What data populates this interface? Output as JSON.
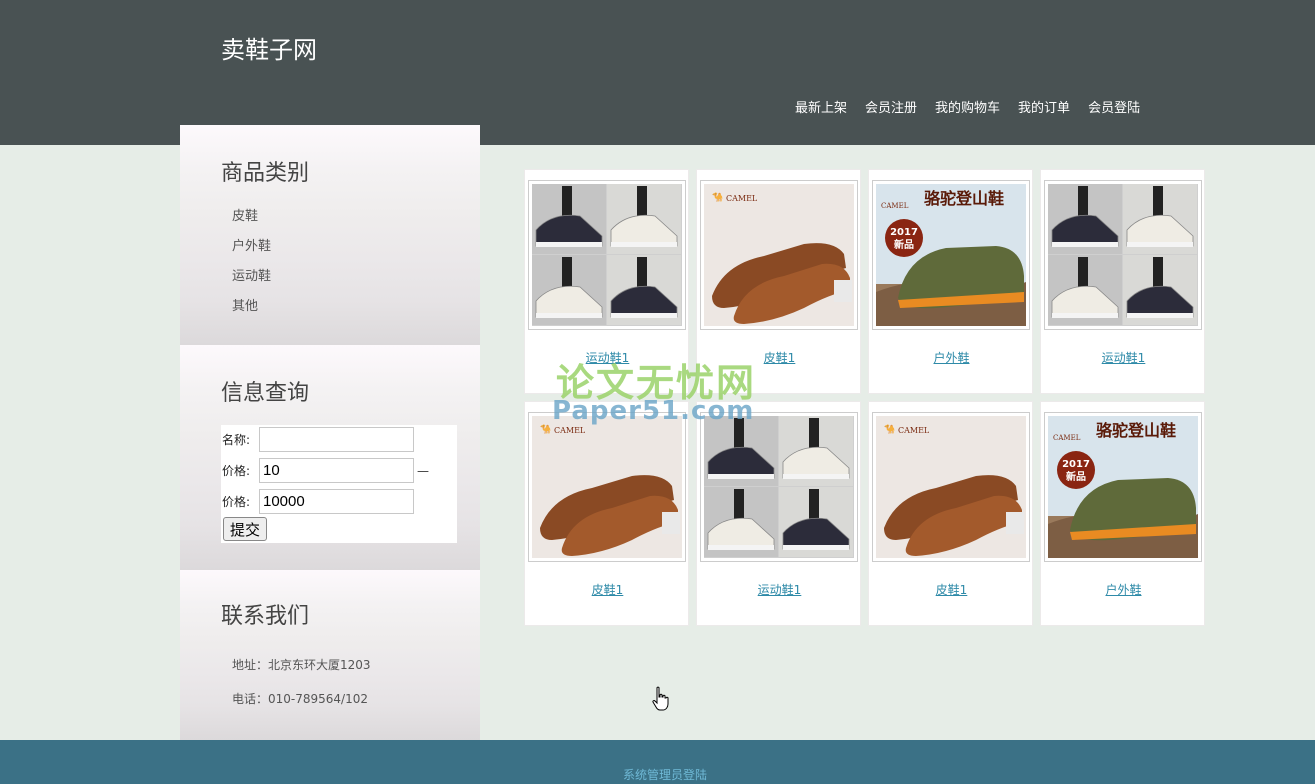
{
  "header": {
    "site_title": "卖鞋子网",
    "nav": [
      "最新上架",
      "会员注册",
      "我的购物车",
      "我的订单",
      "会员登陆"
    ]
  },
  "sidebar": {
    "categories": {
      "title": "商品类别",
      "items": [
        "皮鞋",
        "户外鞋",
        "运动鞋",
        "其他"
      ]
    },
    "search": {
      "title": "信息查询",
      "name_label": "名称:",
      "name_value": "",
      "price_label": "价格:",
      "price_min": "10",
      "price_sep": "—",
      "price_max": "10000",
      "submit": "提交"
    },
    "contact": {
      "title": "联系我们",
      "address": "地址：北京东环大厦1203",
      "phone": "电话：010-789564/102"
    }
  },
  "products": [
    {
      "name": "运动鞋1",
      "image": "sneakers"
    },
    {
      "name": "皮鞋1",
      "image": "leather-shoe"
    },
    {
      "name": "户外鞋",
      "image": "hiking-shoe"
    },
    {
      "name": "运动鞋1",
      "image": "sneakers"
    },
    {
      "name": "皮鞋1",
      "image": "leather-shoe"
    },
    {
      "name": "运动鞋1",
      "image": "sneakers"
    },
    {
      "name": "皮鞋1",
      "image": "leather-shoe"
    },
    {
      "name": "户外鞋",
      "image": "hiking-shoe"
    }
  ],
  "product_image_text": {
    "brand": "CAMEL",
    "banner": "骆驼登山鞋",
    "badge_year": "2017",
    "badge_label": "新品"
  },
  "watermark": {
    "cn": "论文无忧网",
    "en": "Paper51.com"
  },
  "footer": {
    "admin_link": "系统管理员登陆"
  },
  "colors": {
    "header_bg": "#495253",
    "page_bg": "#e6ede7",
    "footer_bg": "#3b7186",
    "link": "#2e8aa8"
  }
}
